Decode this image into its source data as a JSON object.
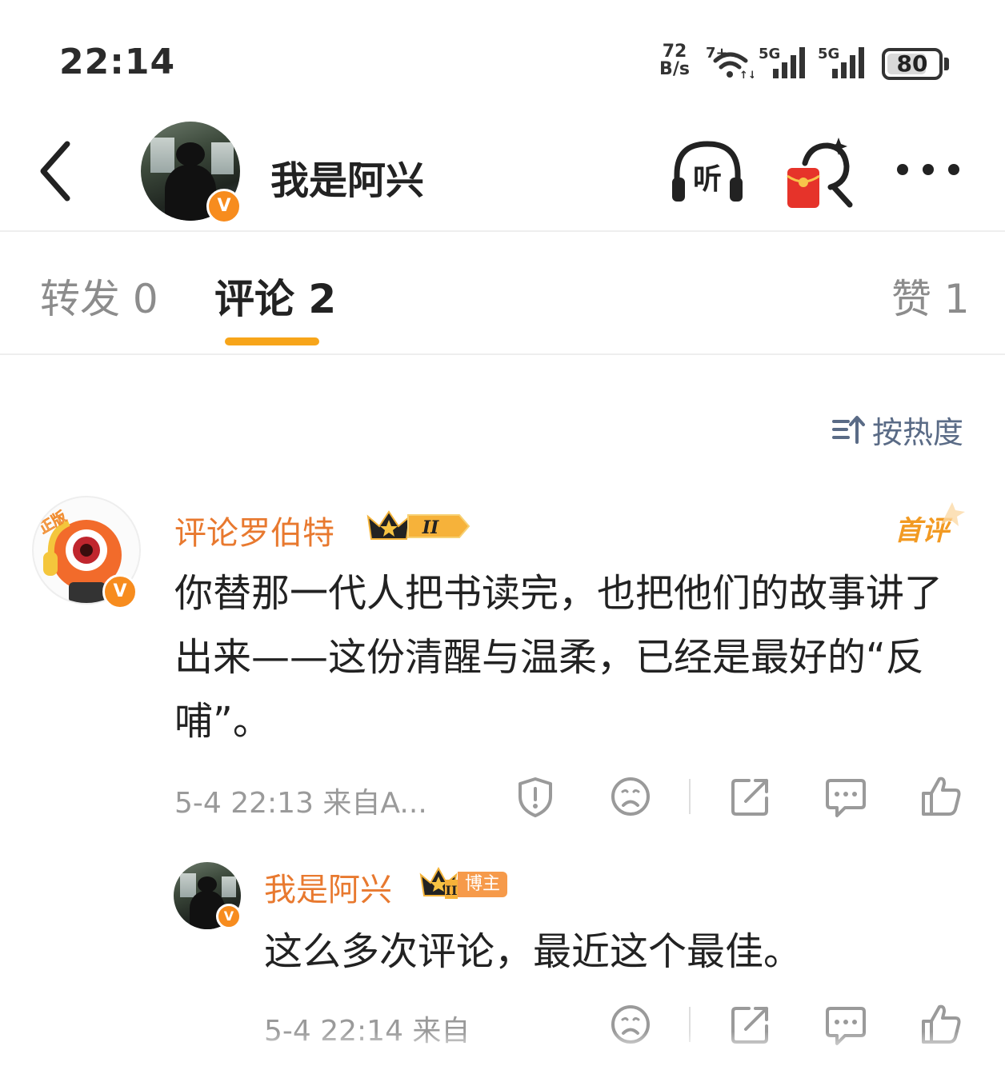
{
  "status_bar": {
    "time": "22:14",
    "net_speed_value": "72",
    "net_speed_unit": "B/s",
    "wifi_label": "7+",
    "signal1_label": "5G",
    "signal2_label": "5G",
    "battery": "80",
    "battery_level": 0.8
  },
  "header": {
    "title": "我是阿兴",
    "listen_label": "听",
    "verified_mark": "V"
  },
  "tabs": [
    {
      "label": "转发 0"
    },
    {
      "label": "评论 2"
    },
    {
      "label": "赞 1"
    }
  ],
  "sort": {
    "label": "按热度"
  },
  "comments": [
    {
      "nickname": "评论罗伯特",
      "level_mark": "II",
      "avatar_tag": "正版",
      "first_comment_tag": "首评",
      "text": "你替那一代人把书读完，也把他们的故事讲了出来——这份清醒与温柔，已经是最好的“反哺”。",
      "meta": "5-4 22:13  来自A...",
      "replies": [
        {
          "nickname": "我是阿兴",
          "level_mark": "II",
          "role_tag": "博主",
          "text": "这么多次评论，最近这个最佳。",
          "meta": "5-4 22:14  来自"
        }
      ]
    }
  ],
  "colors": {
    "accent": "#f7a51a",
    "nickname": "#e8792f",
    "verified": "#f78c1e",
    "sort_text": "#5a6b86",
    "red_packet": "#e6332a"
  }
}
